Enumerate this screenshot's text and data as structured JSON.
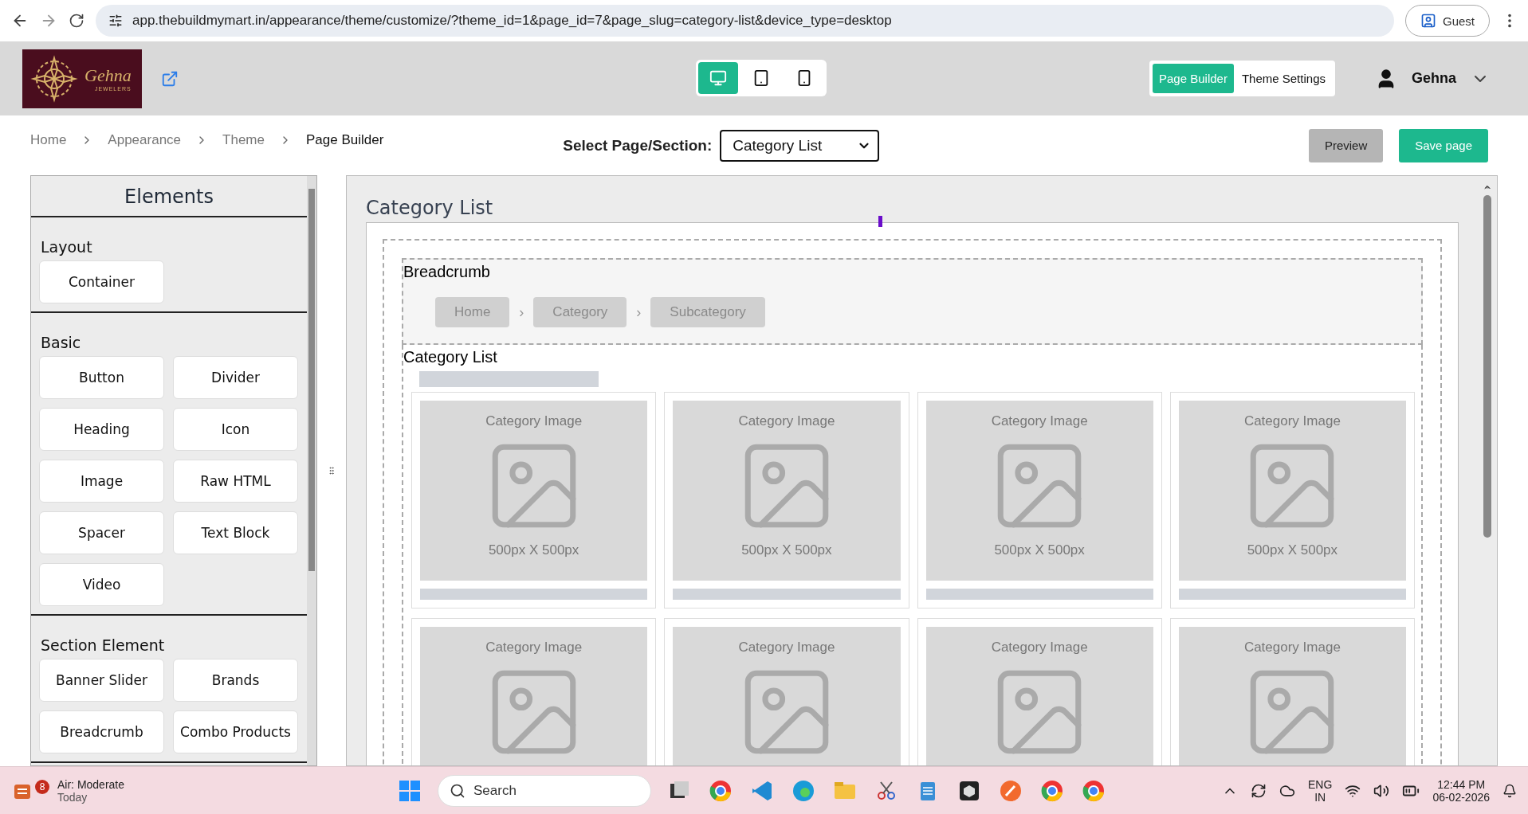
{
  "browser": {
    "url": "app.thebuildmymart.in/appearance/theme/customize/?theme_id=1&page_id=7&page_slug=category-list&device_type=desktop",
    "profile": "Guest"
  },
  "header": {
    "logo_name": "Gehna",
    "logo_sub": "JEWELERS",
    "devices": [
      {
        "kind": "desktop",
        "selected": true
      },
      {
        "kind": "tablet",
        "selected": false
      },
      {
        "kind": "mobile",
        "selected": false
      }
    ],
    "tabs": [
      {
        "label": "Page Builder",
        "selected": true
      },
      {
        "label": "Theme Settings",
        "selected": false
      }
    ],
    "user": "Gehna"
  },
  "breadcrumb": [
    "Home",
    "Appearance",
    "Theme",
    "Page Builder"
  ],
  "page_select": {
    "label": "Select Page/Section:",
    "value": "Category List"
  },
  "actions": [
    {
      "label": "Preview",
      "kind": "secondary"
    },
    {
      "label": "Save page",
      "kind": "primary"
    }
  ],
  "elements": {
    "title": "Elements",
    "groups": [
      {
        "title": "Layout",
        "items": [
          "Container"
        ]
      },
      {
        "title": "Basic",
        "items": [
          "Button",
          "Divider",
          "Heading",
          "Icon",
          "Image",
          "Raw HTML",
          "Spacer",
          "Text Block",
          "Video"
        ]
      },
      {
        "title": "Section Element",
        "items": [
          "Banner Slider",
          "Brands",
          "Breadcrumb",
          "Combo Products"
        ]
      }
    ]
  },
  "canvas": {
    "title": "Category List",
    "breadcrumb_block": {
      "label": "Breadcrumb",
      "crumbs": [
        "Home",
        "Category",
        "Subcategory"
      ],
      "separators": [
        "›",
        "›"
      ]
    },
    "list_block": {
      "label": "Category List",
      "cards": [
        {
          "caption": "Category Image",
          "size": "500px X 500px"
        },
        {
          "caption": "Category Image",
          "size": "500px X 500px"
        },
        {
          "caption": "Category Image",
          "size": "500px X 500px"
        },
        {
          "caption": "Category Image",
          "size": "500px X 500px"
        },
        {
          "caption": "Category Image"
        },
        {
          "caption": "Category Image"
        },
        {
          "caption": "Category Image"
        },
        {
          "caption": "Category Image"
        }
      ]
    }
  },
  "taskbar": {
    "weather_badge": "8",
    "weather": "Air: Moderate",
    "weather_sub": "Today",
    "search": "Search",
    "lang": "ENG",
    "region": "IN",
    "time": "12:44 PM",
    "date": "06-02-2026"
  }
}
